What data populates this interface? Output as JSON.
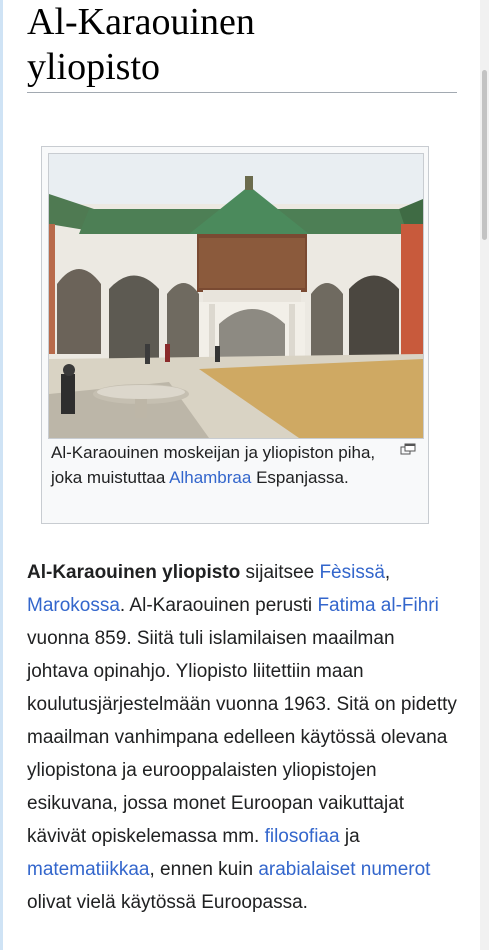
{
  "article": {
    "title_line1": "Al-Karaouinen",
    "title_line2": "yliopisto"
  },
  "figure": {
    "image_description": "courtyard with fountain and green-tiled pavilion",
    "caption_part1": "Al-Karaouinen moskeijan ja yliopiston piha, joka muistuttaa ",
    "caption_link": "Alhambraa",
    "caption_part2": " Espanjassa.",
    "enlarge_icon": "enlarge-icon"
  },
  "body": {
    "bold_subject": "Al-Karaouinen yliopisto",
    "t1": " sijaitsee ",
    "link_fes": "Fèsissä",
    "t2": ", ",
    "link_marokko": "Marokossa",
    "t3": ". Al-Karaouinen perusti ",
    "link_fatima": "Fatima al-Fihri",
    "t4": " vuonna 859. Siitä tuli islamilaisen maailman johtava opinahjo. Yliopisto liitettiin maan koulutusjärjestelmään vuonna 1963. Sitä on pidetty maailman vanhimpana edelleen käytössä olevana yliopistona ja eurooppalaisten yliopistojen esikuvana, jossa monet Euroopan vaikuttajat kävivät opiskelemassa mm. ",
    "link_filosofia": "filosofiaa",
    "t5": " ja ",
    "link_matematiikka": "matematiikkaa",
    "t6": ", ennen kuin ",
    "link_numerot": "arabialaiset numerot",
    "t7": " olivat vielä käytössä Euroopassa."
  },
  "colors": {
    "link": "#3366cc",
    "text": "#202122",
    "border": "#a2a9b1"
  }
}
